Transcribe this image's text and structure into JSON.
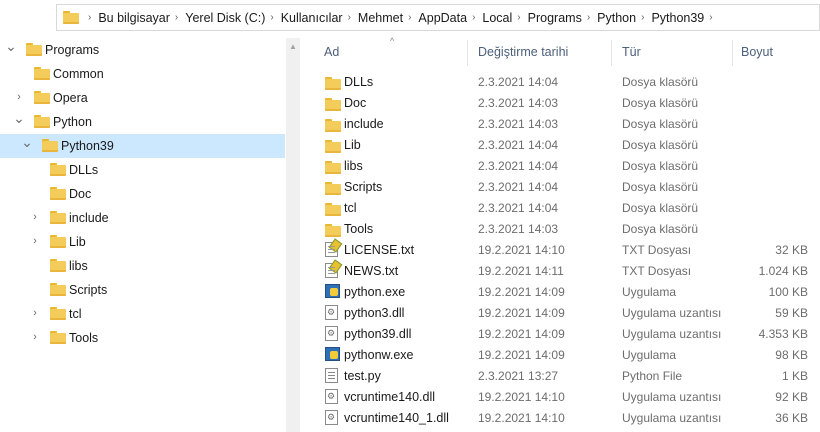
{
  "breadcrumb": [
    "Bu bilgisayar",
    "Yerel Disk (C:)",
    "Kullanıcılar",
    "Mehmet",
    "AppData",
    "Local",
    "Programs",
    "Python",
    "Python39"
  ],
  "tree": [
    {
      "label": "Programs",
      "level": 0,
      "expanded": true,
      "chevron": true
    },
    {
      "label": "Common",
      "level": 1,
      "chevron": false
    },
    {
      "label": "Opera",
      "level": 1,
      "chevron": true
    },
    {
      "label": "Python",
      "level": 1,
      "expanded": true,
      "chevron": true
    },
    {
      "label": "Python39",
      "level": 2,
      "expanded": true,
      "chevron": true,
      "selected": true
    },
    {
      "label": "DLLs",
      "level": 3,
      "chevron": false
    },
    {
      "label": "Doc",
      "level": 3,
      "chevron": false
    },
    {
      "label": "include",
      "level": 3,
      "chevron": true
    },
    {
      "label": "Lib",
      "level": 3,
      "chevron": true
    },
    {
      "label": "libs",
      "level": 3,
      "chevron": false
    },
    {
      "label": "Scripts",
      "level": 3,
      "chevron": false
    },
    {
      "label": "tcl",
      "level": 3,
      "chevron": true
    },
    {
      "label": "Tools",
      "level": 3,
      "chevron": true
    }
  ],
  "columns": {
    "name": "Ad",
    "date": "Değiştirme tarihi",
    "type": "Tür",
    "size": "Boyut"
  },
  "files": [
    {
      "name": "DLLs",
      "date": "2.3.2021 14:04",
      "type": "Dosya klasörü",
      "size": "",
      "icon": "folder-icon"
    },
    {
      "name": "Doc",
      "date": "2.3.2021 14:03",
      "type": "Dosya klasörü",
      "size": "",
      "icon": "folder-icon"
    },
    {
      "name": "include",
      "date": "2.3.2021 14:03",
      "type": "Dosya klasörü",
      "size": "",
      "icon": "folder-icon"
    },
    {
      "name": "Lib",
      "date": "2.3.2021 14:04",
      "type": "Dosya klasörü",
      "size": "",
      "icon": "folder-icon"
    },
    {
      "name": "libs",
      "date": "2.3.2021 14:04",
      "type": "Dosya klasörü",
      "size": "",
      "icon": "folder-icon"
    },
    {
      "name": "Scripts",
      "date": "2.3.2021 14:04",
      "type": "Dosya klasörü",
      "size": "",
      "icon": "folder-icon"
    },
    {
      "name": "tcl",
      "date": "2.3.2021 14:04",
      "type": "Dosya klasörü",
      "size": "",
      "icon": "folder-icon"
    },
    {
      "name": "Tools",
      "date": "2.3.2021 14:03",
      "type": "Dosya klasörü",
      "size": "",
      "icon": "folder-icon"
    },
    {
      "name": "LICENSE.txt",
      "date": "19.2.2021 14:10",
      "type": "TXT Dosyası",
      "size": "32 KB",
      "icon": "text-file-icon"
    },
    {
      "name": "NEWS.txt",
      "date": "19.2.2021 14:11",
      "type": "TXT Dosyası",
      "size": "1.024 KB",
      "icon": "text-file-icon"
    },
    {
      "name": "python.exe",
      "date": "19.2.2021 14:09",
      "type": "Uygulama",
      "size": "100 KB",
      "icon": "python-exe-icon"
    },
    {
      "name": "python3.dll",
      "date": "19.2.2021 14:09",
      "type": "Uygulama uzantısı",
      "size": "59 KB",
      "icon": "dll-file-icon"
    },
    {
      "name": "python39.dll",
      "date": "19.2.2021 14:09",
      "type": "Uygulama uzantısı",
      "size": "4.353 KB",
      "icon": "dll-file-icon"
    },
    {
      "name": "pythonw.exe",
      "date": "19.2.2021 14:09",
      "type": "Uygulama",
      "size": "98 KB",
      "icon": "python-exe-icon"
    },
    {
      "name": "test.py",
      "date": "2.3.2021 13:27",
      "type": "Python File",
      "size": "1 KB",
      "icon": "python-file-icon"
    },
    {
      "name": "vcruntime140.dll",
      "date": "19.2.2021 14:10",
      "type": "Uygulama uzantısı",
      "size": "92 KB",
      "icon": "dll-file-icon"
    },
    {
      "name": "vcruntime140_1.dll",
      "date": "19.2.2021 14:10",
      "type": "Uygulama uzantısı",
      "size": "36 KB",
      "icon": "dll-file-icon"
    }
  ]
}
